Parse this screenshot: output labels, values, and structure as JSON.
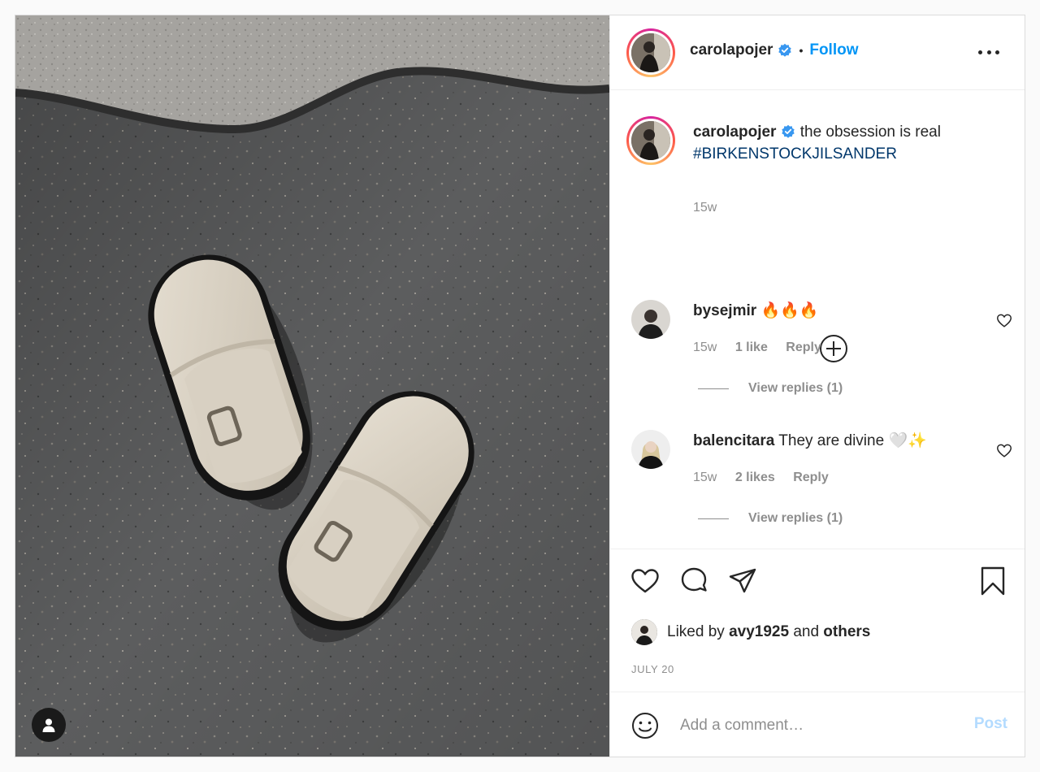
{
  "post": {
    "author": {
      "username": "carolapojer",
      "verified": true,
      "follow_label": "Follow"
    },
    "caption": {
      "username": "carolapojer",
      "text": "the obsession is real",
      "hashtag": "#BIRKENSTOCKJILSANDER",
      "time": "15w"
    },
    "comments": [
      {
        "username": "bysejmir",
        "text": "🔥🔥🔥",
        "time": "15w",
        "likes": "1 like",
        "reply_label": "Reply",
        "view_replies": "View replies (1)"
      },
      {
        "username": "balencitara",
        "text": "They are divine 🤍✨",
        "time": "15w",
        "likes": "2 likes",
        "reply_label": "Reply",
        "view_replies": "View replies (1)"
      }
    ],
    "likes": {
      "prefix": "Liked by",
      "user": "avy1925",
      "conjunction": "and",
      "others": "others"
    },
    "date": "JULY 20",
    "comment_box": {
      "placeholder": "Add a comment…",
      "post_label": "Post"
    },
    "colors": {
      "accent": "#0095f6",
      "hashtag": "#00376b",
      "muted": "#8e8e8e",
      "post_disabled": "#b3dbff"
    },
    "icons": [
      "verified-badge-icon",
      "more-options-icon",
      "load-more-comments-icon",
      "heart-icon",
      "comment-icon",
      "share-icon",
      "bookmark-icon",
      "emoji-icon",
      "user-tag-icon"
    ]
  }
}
